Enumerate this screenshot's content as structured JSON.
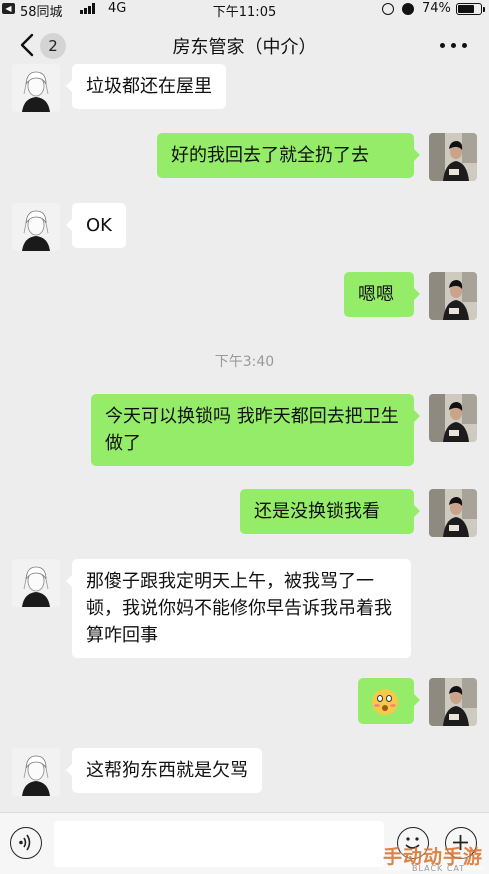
{
  "status_bar": {
    "back_app": "58同城",
    "network": "4G",
    "time": "下午11:05",
    "battery_text": "74%",
    "battery_level": 0.74
  },
  "nav": {
    "back_count": "2",
    "title": "房东管家（中介）",
    "more_icon": "more-icon"
  },
  "messages": [
    {
      "side": "left",
      "text": "垃圾都还在屋里"
    },
    {
      "side": "right",
      "text": "好的我回去了就全扔了去"
    },
    {
      "side": "left",
      "text": "OK"
    },
    {
      "side": "right",
      "text": "嗯嗯"
    },
    {
      "side": "right",
      "text": "今天可以换锁吗 我昨天都回去把卫生做了"
    },
    {
      "side": "right",
      "text": "还是没换锁我看"
    },
    {
      "side": "left",
      "text": "那傻子跟我定明天上午，被我骂了一顿，我说你妈不能修你早告诉我吊着我算咋回事"
    },
    {
      "side": "right",
      "emoji": "flushed-face"
    },
    {
      "side": "left",
      "text": "这帮狗东西就是欠骂"
    }
  ],
  "timestamp": "下午3:40",
  "input_bar": {
    "voice_icon": "voice-icon",
    "emoji_icon": "emoji-icon",
    "plus_icon": "plus-icon"
  },
  "watermark": {
    "text": "手动动手游",
    "sub": "BLACK CAT"
  },
  "colors": {
    "background": "#ededed",
    "bubble_sent": "#95ec69",
    "bubble_received": "#ffffff",
    "timestamp": "#9a9a9a"
  }
}
